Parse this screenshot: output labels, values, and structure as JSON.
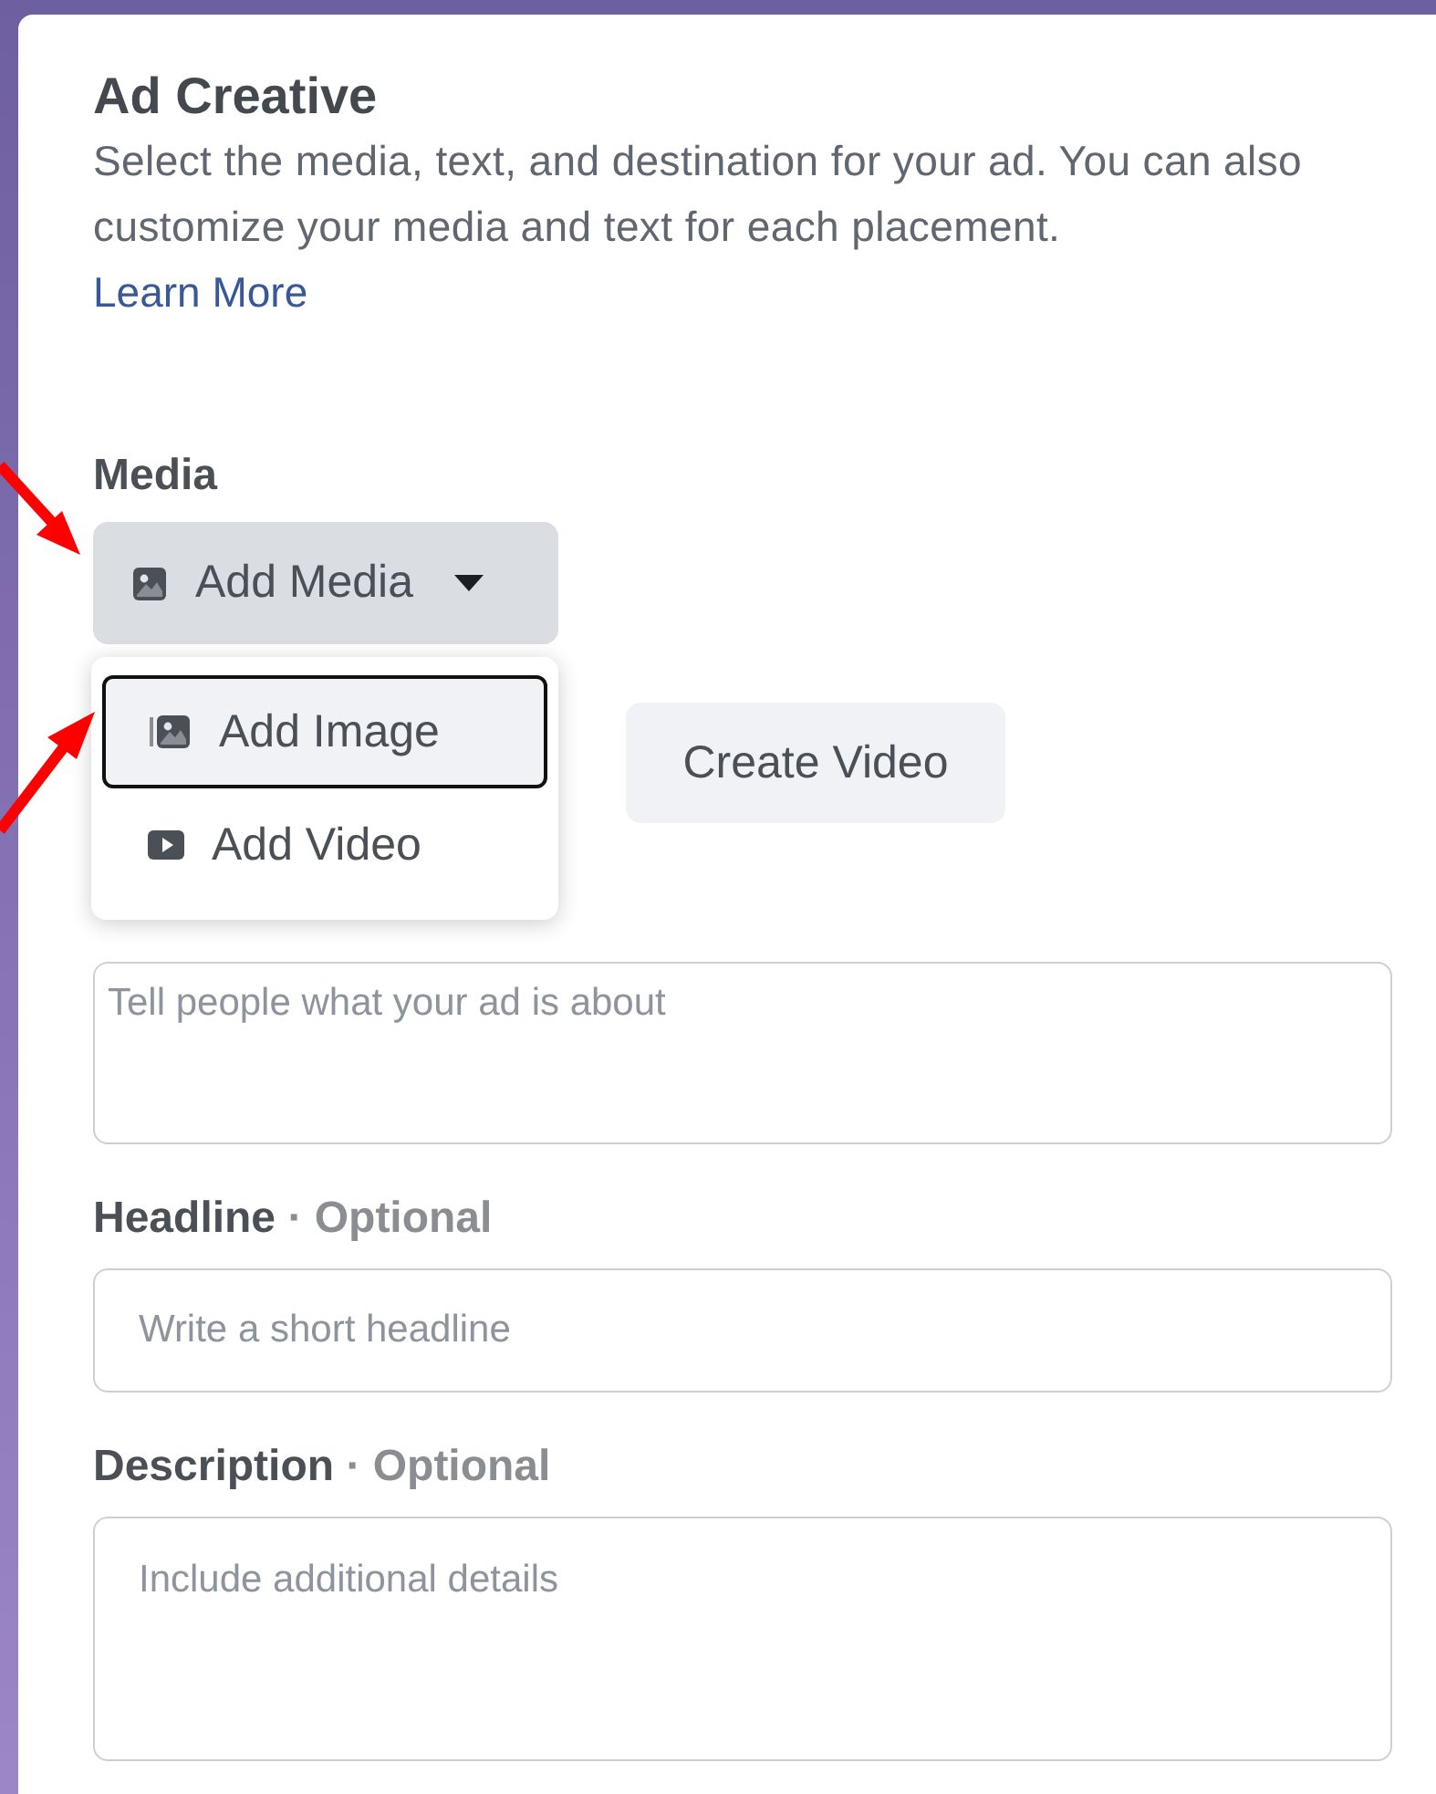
{
  "panel": {
    "title": "Ad Creative",
    "description": "Select the media, text, and destination for your ad. You can also customize your media and text for each placement.",
    "learn_more": "Learn More"
  },
  "media": {
    "label": "Media",
    "button": "Add Media",
    "menu": {
      "open": true,
      "items": [
        {
          "label": "Add Image",
          "kind": "image",
          "selected": true
        },
        {
          "label": "Add Video",
          "kind": "video",
          "selected": false
        }
      ]
    },
    "create_video": "Create Video"
  },
  "fields": [
    {
      "kind": "textarea",
      "placeholder": "Tell people what your ad is about"
    },
    {
      "kind": "input",
      "label": "Headline",
      "optional": "· Optional",
      "placeholder": "Write a short headline"
    },
    {
      "kind": "textarea",
      "label": "Description",
      "optional": "· Optional",
      "placeholder": "Include additional details"
    }
  ]
}
